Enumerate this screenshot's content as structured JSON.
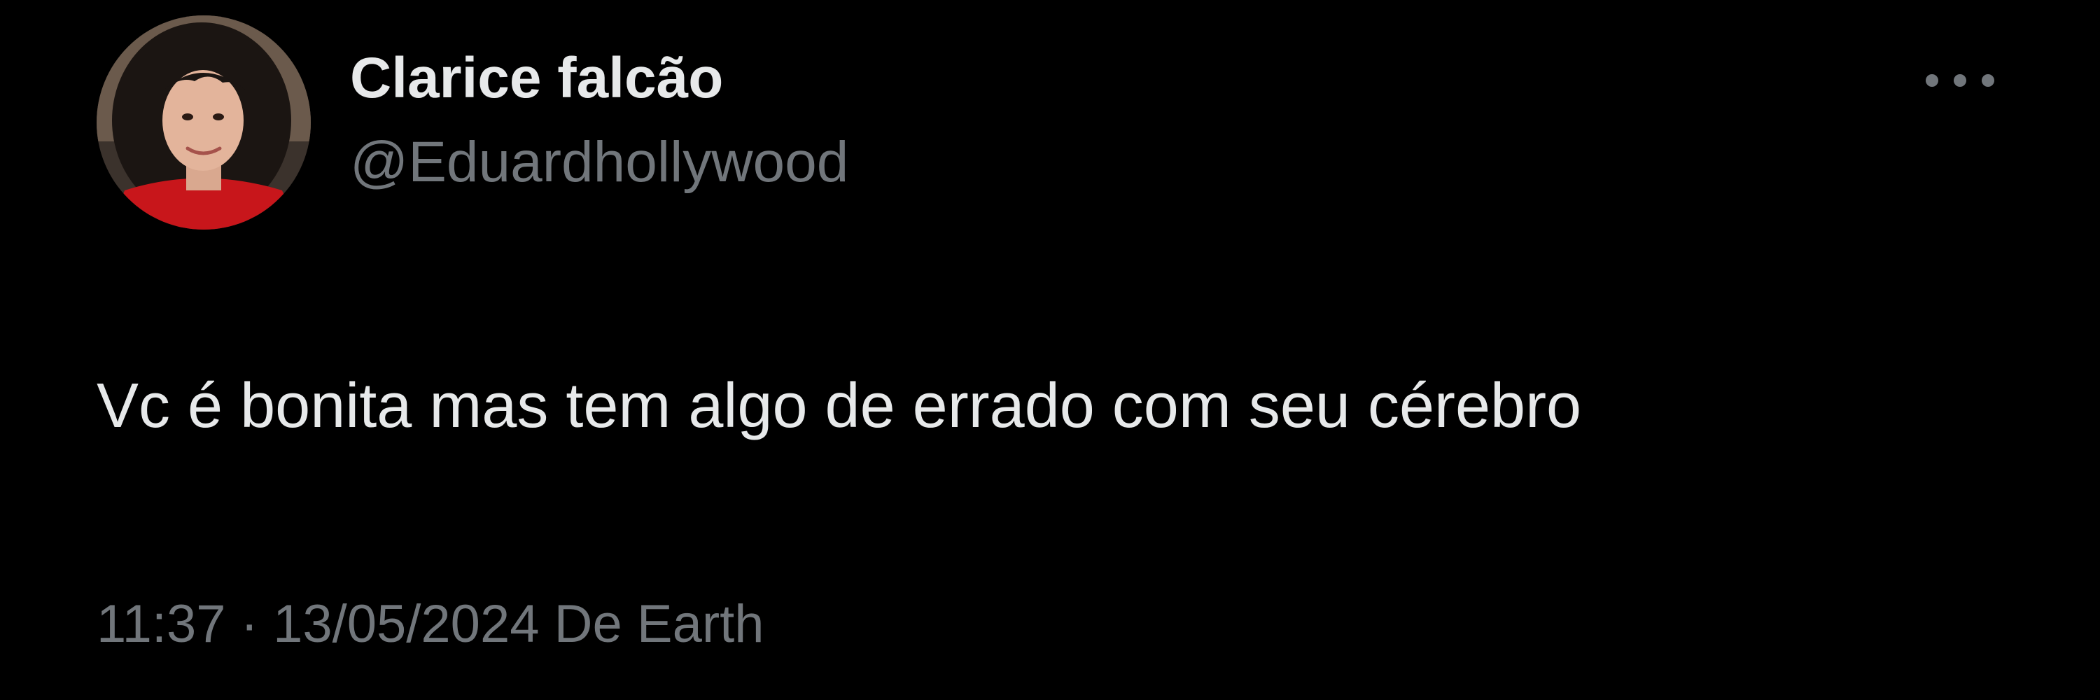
{
  "tweet": {
    "author": {
      "display_name": "Clarice falcão",
      "handle": "@Eduardhollywood",
      "avatar": "profile-photo"
    },
    "more_icon": "ellipsis-icon",
    "text": "Vc é bonita mas tem algo de errado com seu cérebro",
    "meta": {
      "time": "11:37",
      "separator": "·",
      "date": "13/05/2024",
      "source": "De Earth"
    }
  },
  "colors": {
    "background": "#000000",
    "primary_text": "#e7e9ea",
    "secondary_text": "#71767b"
  }
}
